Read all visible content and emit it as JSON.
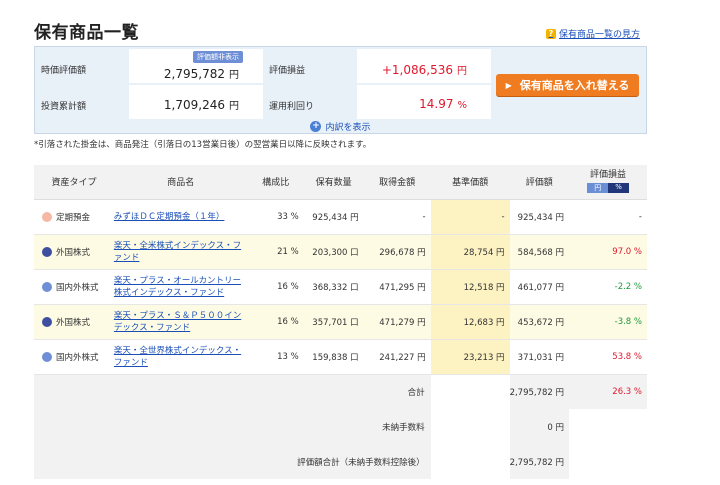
{
  "page": {
    "title": "保有商品一覧",
    "help_link": "保有商品一覧の見方"
  },
  "summary": {
    "market_value_label": "時価評価額",
    "market_value": "2,795,782",
    "investment_label": "投資累計額",
    "investment": "1,709,246",
    "pl_label": "評価損益",
    "pl": "+1,086,536",
    "return_label": "運用利回り",
    "return": "14.97",
    "yen_unit": "円",
    "pct_unit": "%",
    "toggle_badge": "評価額非表示",
    "swap_button": "保有商品を入れ替える",
    "detail_link": "内訳を表示"
  },
  "note": "*引落された掛金は、商品発注（引落日の13営業日後）の翌営業日以降に反映されます。",
  "table": {
    "headers": {
      "type": "資産タイプ",
      "name": "商品名",
      "ratio": "構成比",
      "qty": "保有数量",
      "cost": "取得金額",
      "base": "基準価額",
      "value": "評価額",
      "pl": "評価損益",
      "pl_yen": "円",
      "pl_pct": "%"
    },
    "rows": [
      {
        "type": "定期預金",
        "dot": "#f5b8a4",
        "name": "みずほＤＣ定期預金（１年）",
        "ratio": "33 %",
        "qty": "925,434 円",
        "cost": "-",
        "base": "-",
        "value": "925,434 円",
        "pl": "-",
        "pl_class": ""
      },
      {
        "type": "外国株式",
        "dot": "#3d4f9e",
        "name": "楽天・全米株式インデックス・ファンド",
        "ratio": "21 %",
        "qty": "203,300 口",
        "cost": "296,678 円",
        "base": "28,754 円",
        "value": "584,568 円",
        "pl": "97.0 %",
        "pl_class": "red"
      },
      {
        "type": "国内外株式",
        "dot": "#6e8fd6",
        "name": "楽天・プラス・オールカントリー株式インデックス・ファンド",
        "ratio": "16 %",
        "qty": "368,332 口",
        "cost": "471,295 円",
        "base": "12,518 円",
        "value": "461,077 円",
        "pl": "-2.2 %",
        "pl_class": "green"
      },
      {
        "type": "外国株式",
        "dot": "#3d4f9e",
        "name": "楽天・プラス・Ｓ＆Ｐ５００インデックス・ファンド",
        "ratio": "16 %",
        "qty": "357,701 口",
        "cost": "471,279 円",
        "base": "12,683 円",
        "value": "453,672 円",
        "pl": "-3.8 %",
        "pl_class": "green"
      },
      {
        "type": "国内外株式",
        "dot": "#6e8fd6",
        "name": "楽天・全世界株式インデックス・ファンド",
        "ratio": "13 %",
        "qty": "159,838 口",
        "cost": "241,227 円",
        "base": "23,213 円",
        "value": "371,031 円",
        "pl": "53.8 %",
        "pl_class": "red"
      }
    ],
    "totals": {
      "total_label": "合計",
      "total_value": "2,795,782 円",
      "total_pl": "26.3 %",
      "unpaid_label": "未納手数料",
      "unpaid_value": "0 円",
      "grand_label": "評価額合計（未納手数料控除後）",
      "grand_value": "2,795,782 円"
    }
  }
}
